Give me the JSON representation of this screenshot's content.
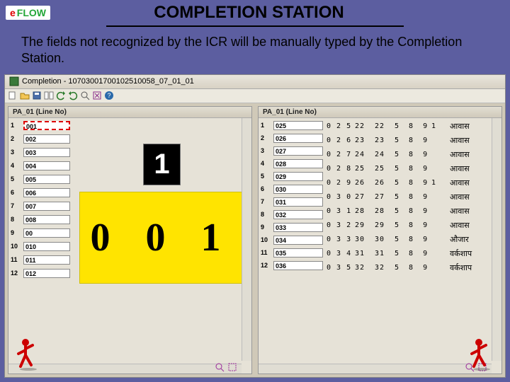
{
  "logo": {
    "part1": "e",
    "part2": "FLOW"
  },
  "title": "COMPLETION STATION",
  "subtitle": "The fields not recognized by the ICR will be manually typed by the Completion Station.",
  "window_title": "Completion - 10703001700102510058_07_01_01",
  "panel_header": "PA_01 (Line No)",
  "left_rows": [
    {
      "idx": "1",
      "val": "001"
    },
    {
      "idx": "2",
      "val": "002"
    },
    {
      "idx": "3",
      "val": "003"
    },
    {
      "idx": "4",
      "val": "004"
    },
    {
      "idx": "5",
      "val": "005"
    },
    {
      "idx": "6",
      "val": "006"
    },
    {
      "idx": "7",
      "val": "007"
    },
    {
      "idx": "8",
      "val": "008"
    },
    {
      "idx": "9",
      "val": "00"
    },
    {
      "idx": "10",
      "val": "010"
    },
    {
      "idx": "11",
      "val": "011"
    },
    {
      "idx": "12",
      "val": "012"
    }
  ],
  "big_preview": "1",
  "yellow_zoom": "0 0 1",
  "right_rows": [
    {
      "idx": "1",
      "val": "025"
    },
    {
      "idx": "2",
      "val": "026"
    },
    {
      "idx": "3",
      "val": "027"
    },
    {
      "idx": "4",
      "val": "028"
    },
    {
      "idx": "5",
      "val": "029"
    },
    {
      "idx": "6",
      "val": "030"
    },
    {
      "idx": "7",
      "val": "031"
    },
    {
      "idx": "8",
      "val": "032"
    },
    {
      "idx": "9",
      "val": "033"
    },
    {
      "idx": "10",
      "val": "034"
    },
    {
      "idx": "11",
      "val": "035"
    },
    {
      "idx": "12",
      "val": "036"
    }
  ],
  "data_rows": [
    {
      "c1": "0 2 5",
      "c2": "22",
      "c3": "22",
      "c4": "5 8 9",
      "c5": "1",
      "label": "आवास"
    },
    {
      "c1": "0 2 6",
      "c2": "23",
      "c3": "23",
      "c4": "5 8 9",
      "c5": "",
      "label": "आवास"
    },
    {
      "c1": "0 2 7",
      "c2": "24",
      "c3": "24",
      "c4": "5 8 9",
      "c5": "",
      "label": "आवास"
    },
    {
      "c1": "0 2 8",
      "c2": "25",
      "c3": "25",
      "c4": "5 8 9",
      "c5": "",
      "label": "आवास"
    },
    {
      "c1": "0 2 9",
      "c2": "26",
      "c3": "26",
      "c4": "5 8 9",
      "c5": "1",
      "label": "आवास"
    },
    {
      "c1": "0 3 0",
      "c2": "27",
      "c3": "27",
      "c4": "5 8 9",
      "c5": "",
      "label": "आवास"
    },
    {
      "c1": "0 3 1",
      "c2": "28",
      "c3": "28",
      "c4": "5 8 9",
      "c5": "",
      "label": "आवास"
    },
    {
      "c1": "0 3 2",
      "c2": "29",
      "c3": "29",
      "c4": "5 8 9",
      "c5": "",
      "label": "आवास"
    },
    {
      "c1": "0 3 3",
      "c2": "30",
      "c3": "30",
      "c4": "5 8 9",
      "c5": "",
      "label": "औजार"
    },
    {
      "c1": "0 3 4",
      "c2": "31",
      "c3": "31",
      "c4": "5 8 9",
      "c5": "",
      "label": "वर्कशाप"
    },
    {
      "c1": "0 3 5",
      "c2": "32",
      "c3": "32",
      "c4": "5 8 9",
      "c5": "",
      "label": "वर्कशाप"
    },
    {
      "c1": "",
      "c2": "",
      "c3": "",
      "c4": "",
      "c5": "",
      "label": ""
    }
  ]
}
